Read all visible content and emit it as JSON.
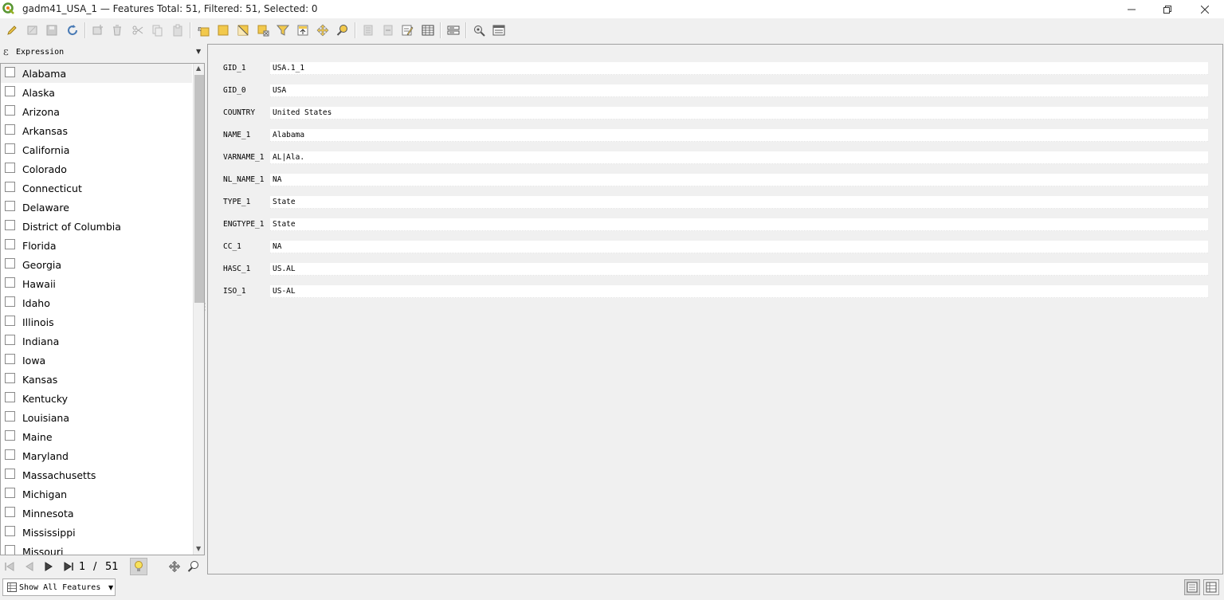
{
  "window": {
    "title": "gadm41_USA_1 — Features Total: 51, Filtered: 51, Selected: 0"
  },
  "toolbar": {
    "icons": [
      "pencil-icon",
      "multi-edit-icon",
      "save-edits-icon",
      "reload-icon",
      "add-feature-icon",
      "delete-feature-icon",
      "cut-icon",
      "copy-icon",
      "paste-icon",
      "select-by-expression-icon",
      "select-all-icon",
      "invert-selection-icon",
      "deselect-all-icon",
      "filter-icon",
      "move-selection-to-top-icon",
      "pan-map-icon",
      "zoom-map-icon",
      "new-field-icon",
      "delete-field-icon",
      "field-calculator-icon",
      "conditional-formatting-icon",
      "actions-icon",
      "dock-icon",
      "table-view-icon"
    ]
  },
  "expression": {
    "label": "Expression"
  },
  "features": {
    "items": [
      "Alabama",
      "Alaska",
      "Arizona",
      "Arkansas",
      "California",
      "Colorado",
      "Connecticut",
      "Delaware",
      "District of Columbia",
      "Florida",
      "Georgia",
      "Hawaii",
      "Idaho",
      "Illinois",
      "Indiana",
      "Iowa",
      "Kansas",
      "Kentucky",
      "Louisiana",
      "Maine",
      "Maryland",
      "Massachusetts",
      "Michigan",
      "Minnesota",
      "Mississippi",
      "Missouri"
    ],
    "selected": "Alabama"
  },
  "navigation": {
    "current": "1",
    "separator": "/",
    "total": "51"
  },
  "filter": {
    "label": "Show All Features"
  },
  "form": {
    "fields": [
      {
        "name": "GID_1",
        "value": "USA.1_1"
      },
      {
        "name": "GID_0",
        "value": "USA"
      },
      {
        "name": "COUNTRY",
        "value": "United States"
      },
      {
        "name": "NAME_1",
        "value": "Alabama"
      },
      {
        "name": "VARNAME_1",
        "value": "AL|Ala."
      },
      {
        "name": "NL_NAME_1",
        "value": "NA"
      },
      {
        "name": "TYPE_1",
        "value": "State"
      },
      {
        "name": "ENGTYPE_1",
        "value": "State"
      },
      {
        "name": "CC_1",
        "value": "NA"
      },
      {
        "name": "HASC_1",
        "value": "US.AL"
      },
      {
        "name": "ISO_1",
        "value": "US-AL"
      }
    ]
  },
  "colors": {
    "accent_yellow": "#f2c94c",
    "selection_bg": "#f0f0f0"
  }
}
